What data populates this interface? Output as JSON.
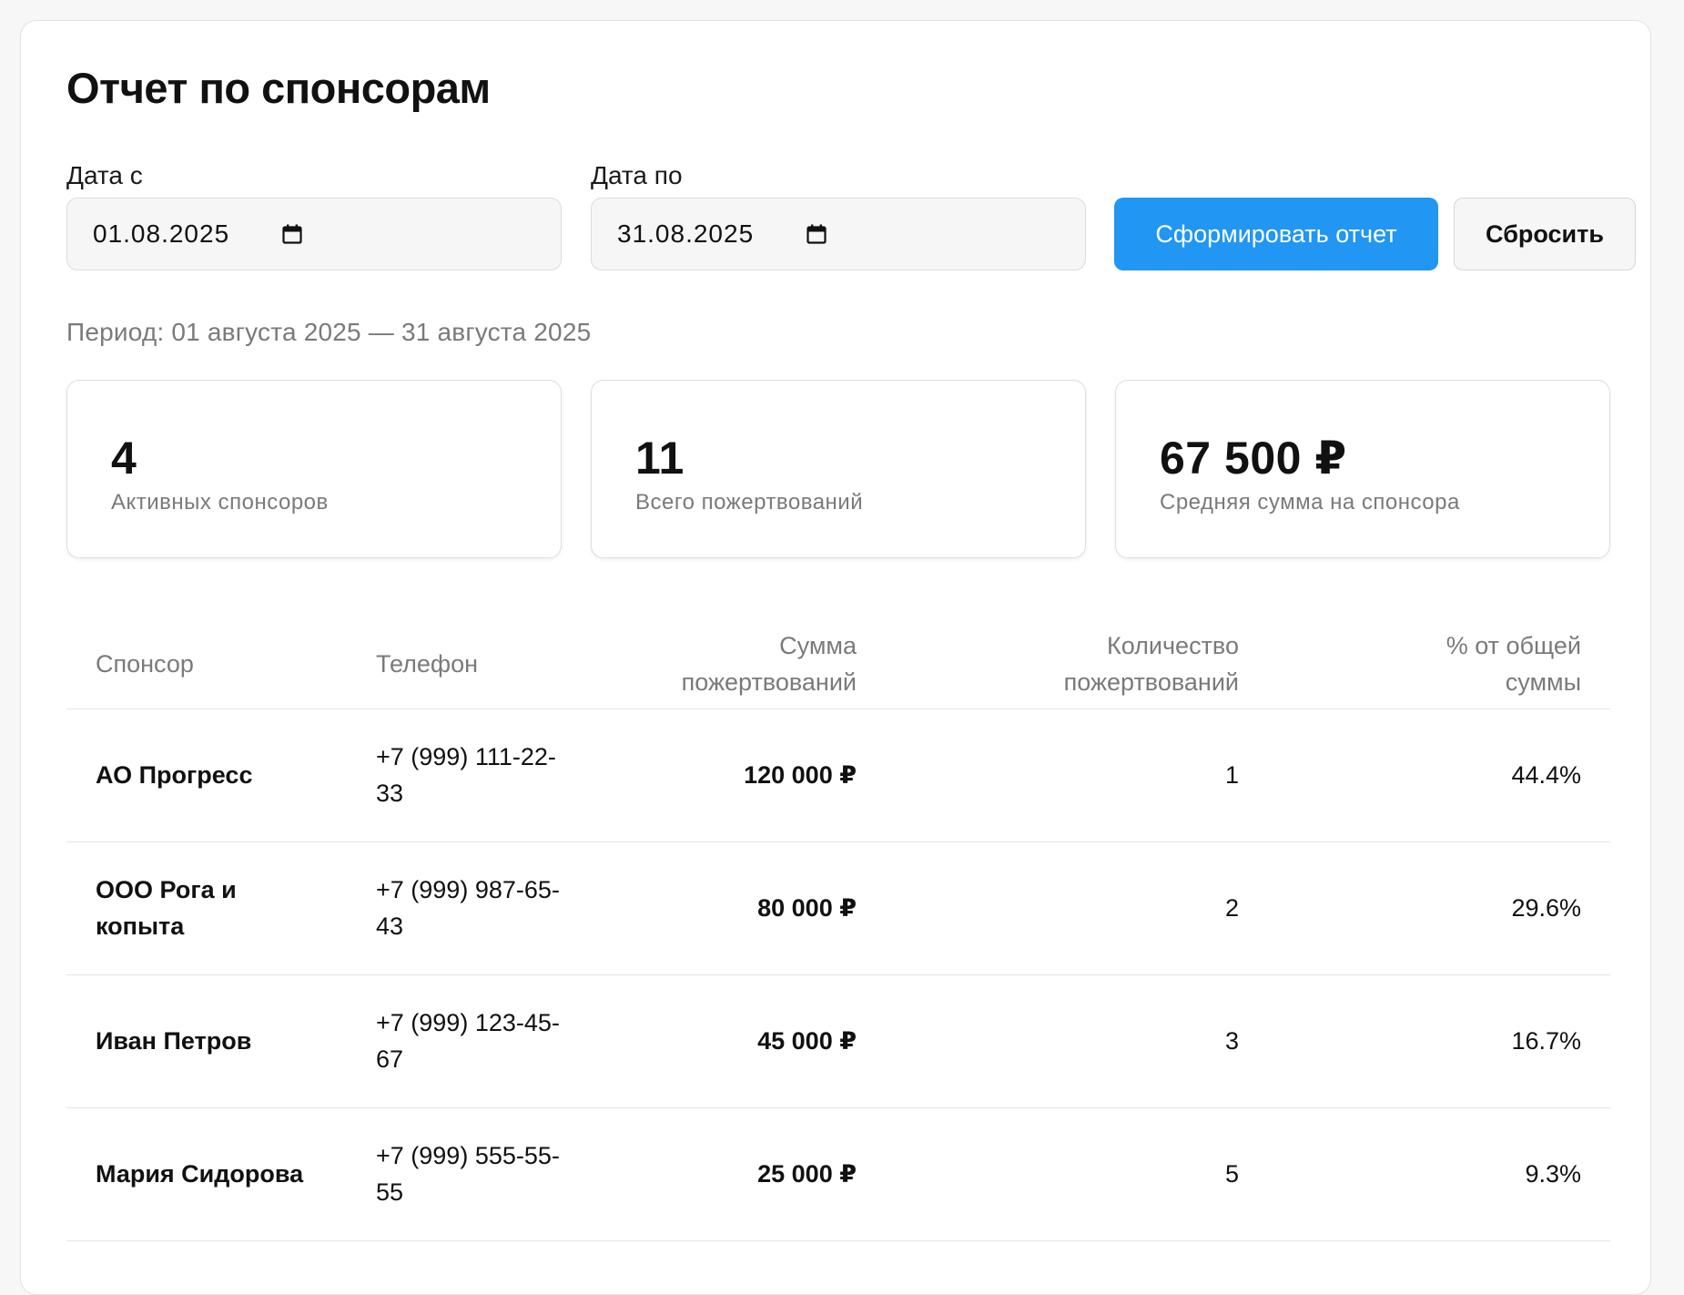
{
  "page": {
    "title": "Отчет по спонсорам"
  },
  "filters": {
    "date_from_label": "Дата с",
    "date_from_value": "01.08.2025",
    "date_to_label": "Дата по",
    "date_to_value": "31.08.2025",
    "generate_label": "Сформировать отчет",
    "reset_label": "Сбросить"
  },
  "period_text": "Период: 01 августа 2025 — 31 августа 2025",
  "stats": [
    {
      "value": "4",
      "label": "Активных спонсоров"
    },
    {
      "value": "11",
      "label": "Всего пожертвований"
    },
    {
      "value": "67 500 ₽",
      "label": "Средняя сумма на спонсора"
    }
  ],
  "table": {
    "headers": {
      "sponsor": "Спонсор",
      "phone": "Телефон",
      "sum_line1": "Сумма",
      "sum_line2": "пожертвований",
      "count_line1": "Количество",
      "count_line2": "пожертвований",
      "pct_line1": "% от общей",
      "pct_line2": "суммы"
    },
    "rows": [
      {
        "name_line1": "АО Прогресс",
        "name_line2": "",
        "phone_line1": "+7 (999) 111-22-",
        "phone_line2": "33",
        "sum": "120 000 ₽",
        "count": "1",
        "pct": "44.4%"
      },
      {
        "name_line1": "ООО Рога и",
        "name_line2": "копыта",
        "phone_line1": "+7 (999) 987-65-",
        "phone_line2": "43",
        "sum": "80 000 ₽",
        "count": "2",
        "pct": "29.6%"
      },
      {
        "name_line1": "Иван Петров",
        "name_line2": "",
        "phone_line1": "+7 (999) 123-45-",
        "phone_line2": "67",
        "sum": "45 000 ₽",
        "count": "3",
        "pct": "16.7%"
      },
      {
        "name_line1": "Мария Сидорова",
        "name_line2": "",
        "phone_line1": "+7 (999) 555-55-",
        "phone_line2": "55",
        "sum": "25 000 ₽",
        "count": "5",
        "pct": "9.3%"
      }
    ]
  },
  "colors": {
    "primary": "#2196f3",
    "muted_text": "#7a7a7a",
    "border": "#e2e2e2"
  },
  "icons": {
    "date_picker": "calendar-icon"
  }
}
